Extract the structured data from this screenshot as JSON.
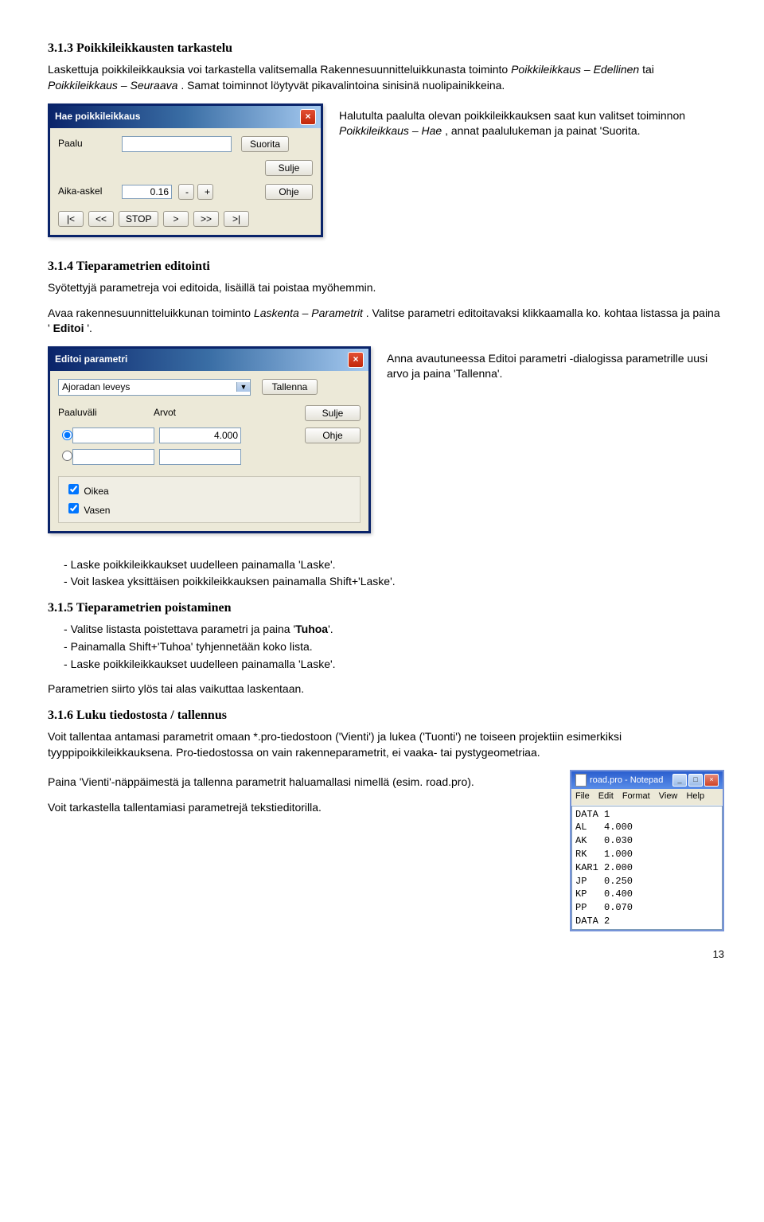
{
  "s313": {
    "heading": "3.1.3 Poikkileikkausten tarkastelu",
    "p1_a": "Laskettuja poikkileikkauksia voi tarkastella valitsemalla Rakennesuunnitteluikkunasta toiminto ",
    "p1_b": "Poikkileikkaus – Edellinen",
    "p1_c": " tai ",
    "p1_d": "Poikkileikkaus – Seuraava",
    "p1_e": ". Samat toiminnot löytyvät pikavalintoina sinisinä nuolipainikkeina.",
    "p2_a": "Halutulta paalulta olevan poikkileikkauksen saat kun valitset toiminnon ",
    "p2_b": "Poikkileikkaus – Hae",
    "p2_c": ", annat paalulukeman ja painat 'Suorita."
  },
  "dlg1": {
    "title": "Hae poikkileikkaus",
    "paalu": "Paalu",
    "aika": "Aika-askel",
    "aika_val": "0.16",
    "minus": "-",
    "plus": "+",
    "suorita": "Suorita",
    "sulje": "Sulje",
    "ohje": "Ohje",
    "nav_first": "|<",
    "nav_prev": "<<",
    "nav_stop": "STOP",
    "nav_next": ">",
    "nav_fwd": ">>",
    "nav_last": ">|"
  },
  "s314": {
    "heading": "3.1.4 Tieparametrien editointi",
    "p1": "Syötettyjä parametreja voi editoida, lisäillä tai poistaa myöhemmin.",
    "p2_a": "Avaa rakennesuunnitteluikkunan toiminto ",
    "p2_b": "Laskenta – Parametrit",
    "p2_c": ". Valitse parametri editoitavaksi klikkaamalla ko. kohtaa listassa ja paina '",
    "p2_d": "Editoi",
    "p2_e": "'.",
    "p3": "Anna avautuneessa Editoi parametri -dialogissa parametrille uusi arvo ja paina 'Tallenna'."
  },
  "dlg2": {
    "title": "Editoi parametri",
    "combo": "Ajoradan leveys",
    "tallenna": "Tallenna",
    "paaluvali": "Paaluväli",
    "arvot": "Arvot",
    "sulje": "Sulje",
    "ohje": "Ohje",
    "val": "4.000",
    "oikea": "Oikea",
    "vasen": "Vasen"
  },
  "list1": {
    "i1": "Laske poikkileikkaukset uudelleen painamalla 'Laske'.",
    "i2": "Voit laskea yksittäisen poikkileikkauksen painamalla Shift+'Laske'."
  },
  "s315": {
    "heading": "3.1.5 Tieparametrien poistaminen"
  },
  "list2": {
    "i1": "Valitse listasta poistettava parametri ja paina '",
    "i1b": "Tuhoa",
    "i1c": "'.",
    "i2": "Painamalla Shift+'Tuhoa' tyhjennetään koko lista.",
    "i3": "Laske poikkileikkaukset uudelleen painamalla 'Laske'."
  },
  "p_siirto": "Parametrien siirto ylös tai alas vaikuttaa laskentaan.",
  "s316": {
    "heading": "3.1.6 Luku tiedostosta / tallennus",
    "p1": "Voit tallentaa antamasi parametrit omaan *.pro-tiedostoon ('Vienti') ja lukea ('Tuonti') ne toiseen projektiin esimerkiksi tyyppipoikkileikkauksena. Pro-tiedostossa on vain rakenneparametrit, ei vaaka- tai pystygeometriaa.",
    "p2": "Paina 'Vienti'-näppäimestä ja tallenna parametrit haluamallasi nimellä (esim. road.pro).",
    "p3": "Voit tarkastella tallentamiasi parametrejä tekstieditorilla."
  },
  "notepad": {
    "title": "road.pro - Notepad",
    "menu_file": "File",
    "menu_edit": "Edit",
    "menu_format": "Format",
    "menu_view": "View",
    "menu_help": "Help",
    "body": "DATA 1\nAL   4.000\nAK   0.030\nRK   1.000\nKAR1 2.000\nJP   0.250\nKP   0.400\nPP   0.070\nDATA 2"
  },
  "pagenum": "13"
}
